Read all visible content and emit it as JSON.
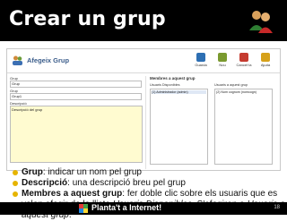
{
  "slide": {
    "title": "Crear un grup",
    "page_number": "18"
  },
  "screenshot": {
    "app_title": "Afegeix Grup",
    "toolbar": [
      {
        "label": "Guarda",
        "icon": "save-icon",
        "color": "#2d6fb3"
      },
      {
        "label": "Nou",
        "icon": "new-icon",
        "color": "#7a9a2f"
      },
      {
        "label": "Cancel·la",
        "icon": "cancel-icon",
        "color": "#c53b2f"
      },
      {
        "label": "Ajuda",
        "icon": "help-icon",
        "color": "#d6a11a"
      }
    ],
    "form": {
      "group_label": "Grup",
      "group_value": "Grup",
      "name_label": "Grup",
      "name_value": "Grup1",
      "description_label": "Descripció",
      "description_value": "Descripció del grup"
    },
    "members": {
      "header": "Membres a aquest grup",
      "available_label": "Usuaris Disponibles",
      "selected_label": "Usuaris a aquest grup",
      "available_items": [
        "(1) Administrador (admin)"
      ],
      "selected_items": [
        "(2) Nom cognom (nomcogn)"
      ]
    }
  },
  "bullets": [
    {
      "term": "Grup",
      "text": ": indicar un nom pel grup"
    },
    {
      "term": "Descripció",
      "text": ": una descripció breu pel grup"
    },
    {
      "term": "Membres a aquest grup",
      "text": ": fer doble clic sobre els usuaris que es volen afegir de la llista ",
      "em1": "Usuaris Disponibles",
      "tail1": ". S'afegiran a ",
      "em2": "Usuaris a aquest grup",
      "tail2": "."
    }
  ],
  "footer": {
    "text": "Planta't a Internet!"
  },
  "colors": {
    "title_bar": "#000000",
    "bullet": "#e6b400",
    "footer": "#000000"
  }
}
